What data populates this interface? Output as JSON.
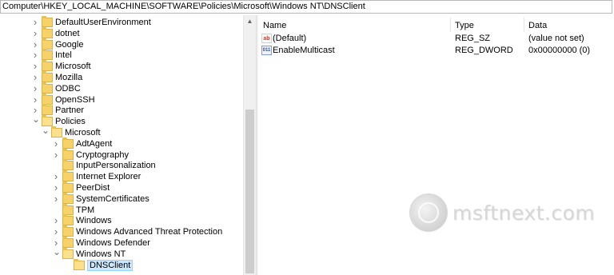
{
  "address_bar": {
    "path": "Computer\\HKEY_LOCAL_MACHINE\\SOFTWARE\\Policies\\Microsoft\\Windows NT\\DNSClient"
  },
  "tree": {
    "items": [
      {
        "label": "DefaultUserEnvironment",
        "level": 1,
        "state": "collapsed"
      },
      {
        "label": "dotnet",
        "level": 1,
        "state": "collapsed"
      },
      {
        "label": "Google",
        "level": 1,
        "state": "collapsed"
      },
      {
        "label": "Intel",
        "level": 1,
        "state": "collapsed"
      },
      {
        "label": "Microsoft",
        "level": 1,
        "state": "collapsed"
      },
      {
        "label": "Mozilla",
        "level": 1,
        "state": "collapsed"
      },
      {
        "label": "ODBC",
        "level": 1,
        "state": "collapsed"
      },
      {
        "label": "OpenSSH",
        "level": 1,
        "state": "collapsed"
      },
      {
        "label": "Partner",
        "level": 1,
        "state": "collapsed"
      },
      {
        "label": "Policies",
        "level": 1,
        "state": "expanded"
      },
      {
        "label": "Microsoft",
        "level": 2,
        "state": "expanded"
      },
      {
        "label": "AdtAgent",
        "level": 3,
        "state": "collapsed"
      },
      {
        "label": "Cryptography",
        "level": 3,
        "state": "collapsed"
      },
      {
        "label": "InputPersonalization",
        "level": 3,
        "state": "none"
      },
      {
        "label": "Internet Explorer",
        "level": 3,
        "state": "collapsed"
      },
      {
        "label": "PeerDist",
        "level": 3,
        "state": "collapsed"
      },
      {
        "label": "SystemCertificates",
        "level": 3,
        "state": "collapsed"
      },
      {
        "label": "TPM",
        "level": 3,
        "state": "none"
      },
      {
        "label": "Windows",
        "level": 3,
        "state": "collapsed"
      },
      {
        "label": "Windows Advanced Threat Protection",
        "level": 3,
        "state": "collapsed"
      },
      {
        "label": "Windows Defender",
        "level": 3,
        "state": "collapsed"
      },
      {
        "label": "Windows NT",
        "level": 3,
        "state": "expanded"
      },
      {
        "label": "DNSClient",
        "level": 4,
        "state": "selected"
      }
    ]
  },
  "values_pane": {
    "columns": {
      "name": "Name",
      "type": "Type",
      "data": "Data"
    },
    "rows": [
      {
        "icon": "string-value-icon",
        "icon_glyph": "ab",
        "name": "(Default)",
        "type": "REG_SZ",
        "data": "(value not set)"
      },
      {
        "icon": "dword-value-icon",
        "icon_glyph": "011",
        "name": "EnableMulticast",
        "type": "REG_DWORD",
        "data": "0x00000000 (0)"
      }
    ]
  },
  "watermark": {
    "text": "msftnext.com"
  },
  "colors": {
    "folder": "#f7d26a",
    "selection": "#cce8ff",
    "selection_border": "#99d1ff"
  }
}
